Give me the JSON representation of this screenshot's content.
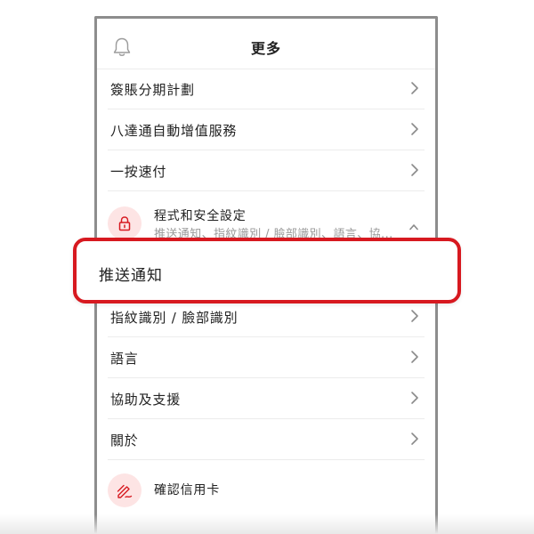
{
  "header": {
    "title": "更多",
    "icon": "bell-icon"
  },
  "menu_items": [
    {
      "label": "簽賬分期計劃"
    },
    {
      "label": "八達通自動增值服務"
    },
    {
      "label": "一按速付"
    }
  ],
  "security_section": {
    "title": "程式和安全設定",
    "subtitle": "推送通知、指紋識別 / 臉部識別、語言、協...",
    "icon": "lock-icon",
    "expanded": true
  },
  "highlighted_item": {
    "label": "推送通知"
  },
  "sub_items": [
    {
      "label": "指紋識別 / 臉部識別"
    },
    {
      "label": "語言"
    },
    {
      "label": "協助及支援"
    },
    {
      "label": "關於"
    }
  ],
  "card_item": {
    "label": "確認信用卡",
    "icon": "card-confirm-icon"
  },
  "colors": {
    "accent": "#d71920",
    "icon_background": "#fde4e4",
    "text": "#222222",
    "muted_text": "#9a9a9a",
    "divider": "#ececec",
    "frame": "#8d8d8d"
  }
}
